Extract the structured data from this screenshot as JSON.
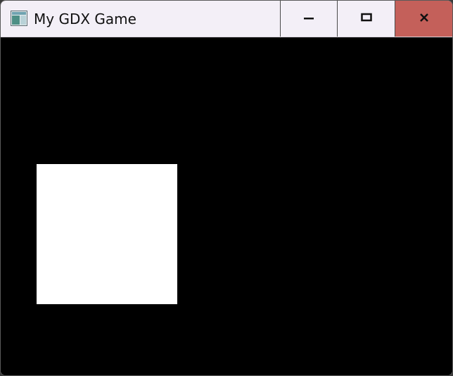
{
  "window": {
    "title": "My GDX Game",
    "icon": "app-window-icon",
    "controls": {
      "minimize_icon": "minimize-icon",
      "maximize_icon": "maximize-icon",
      "close_icon": "close-icon"
    }
  },
  "game": {
    "background_color": "#000000",
    "sprite_color": "#ffffff"
  },
  "colors": {
    "titlebar": "#f3eff7",
    "close_button": "#c4605a"
  }
}
